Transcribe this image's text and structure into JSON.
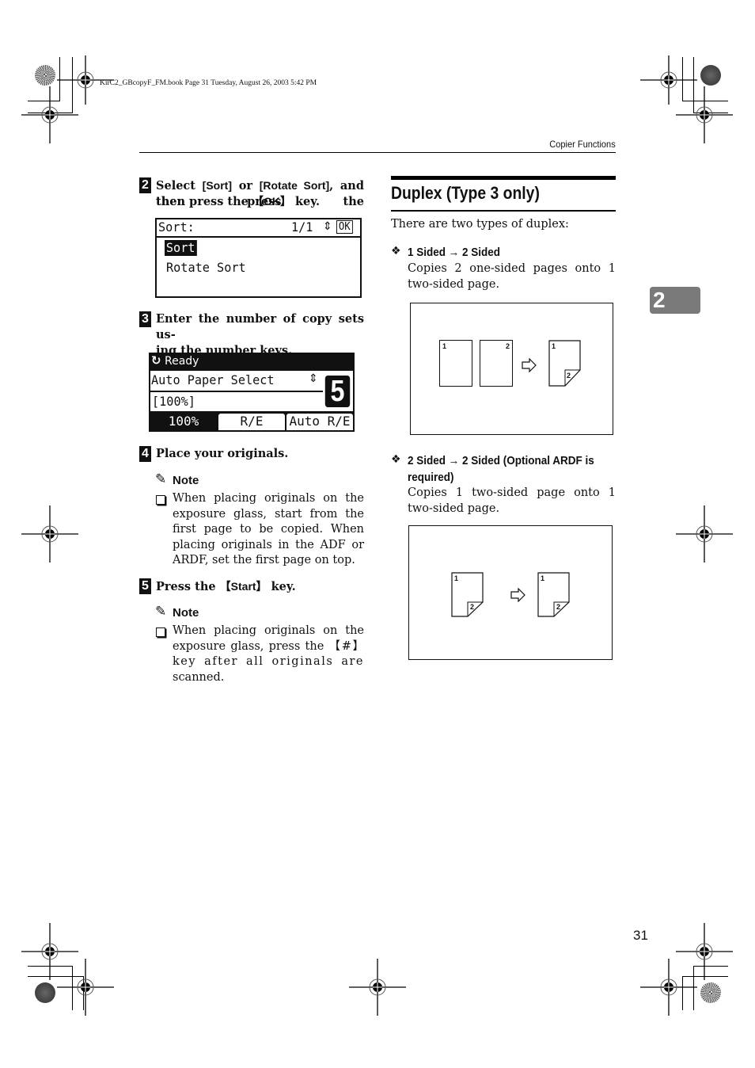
{
  "print_meta": {
    "slug": "KirC2_GBcopyF_FM.book  Page 31  Tuesday, August 26, 2003  5:42 PM"
  },
  "running_header": "Copier Functions",
  "chapter_tab": "2",
  "page_number": "31",
  "steps": [
    {
      "number": "2",
      "text_parts": [
        "Select ",
        "[Sort]",
        " or ",
        "[Rotate Sort]",
        ", and then press the ",
        "【OK】",
        " key."
      ],
      "lcd": {
        "title": "Sort:",
        "page": "1/1",
        "scroll_icon": "⇕",
        "ok_label": "OK",
        "options": [
          "Sort",
          "Rotate Sort"
        ],
        "selected_index": 0
      }
    },
    {
      "number": "3",
      "text": "Enter the number of copy sets us-ing the number keys.",
      "text_line1": "Enter the number of copy sets us-",
      "text_line2": "ing the number keys.",
      "lcd": {
        "status": "Ready",
        "paper": "Auto Paper Select",
        "ratio": "[100%]",
        "copies": "5",
        "tabs": [
          "100%",
          "R/E",
          "Auto R/E"
        ],
        "active_tab_index": 0
      }
    },
    {
      "number": "4",
      "text": "Place your originals.",
      "note": {
        "heading": "Note",
        "body_lines": [
          "When placing originals on the",
          "exposure glass, start from the",
          "first page to be copied. When",
          "placing originals in the ADF or",
          "ARDF, set the first page on top."
        ]
      }
    },
    {
      "number": "5",
      "text_parts": [
        "Press the ",
        "【Start】",
        " key."
      ],
      "note": {
        "heading": "Note",
        "body_lines": [
          "When placing originals on the",
          "exposure glass, press the 【#】",
          "key after all originals are",
          "scanned."
        ]
      }
    }
  ],
  "section": {
    "title": "Duplex (Type 3 only)",
    "intro": "There are two types of duplex:",
    "types": [
      {
        "bullet": "❖",
        "heading": "1 Sided → 2 Sided",
        "description_lines": [
          "Copies 2 one-sided pages onto 1",
          "two-sided page."
        ],
        "diagram": {
          "originals": [
            "1",
            "2"
          ],
          "result_front": "1",
          "result_back": "2"
        }
      },
      {
        "bullet": "❖",
        "heading_line1": "2 Sided → 2 Sided (Optional ARDF is",
        "heading_line2": "required)",
        "description_lines": [
          "Copies 1 two-sided page onto 1",
          "two-sided page."
        ],
        "diagram": {
          "original_front": "1",
          "original_back": "2",
          "result_front": "1",
          "result_back": "2"
        }
      }
    ]
  }
}
